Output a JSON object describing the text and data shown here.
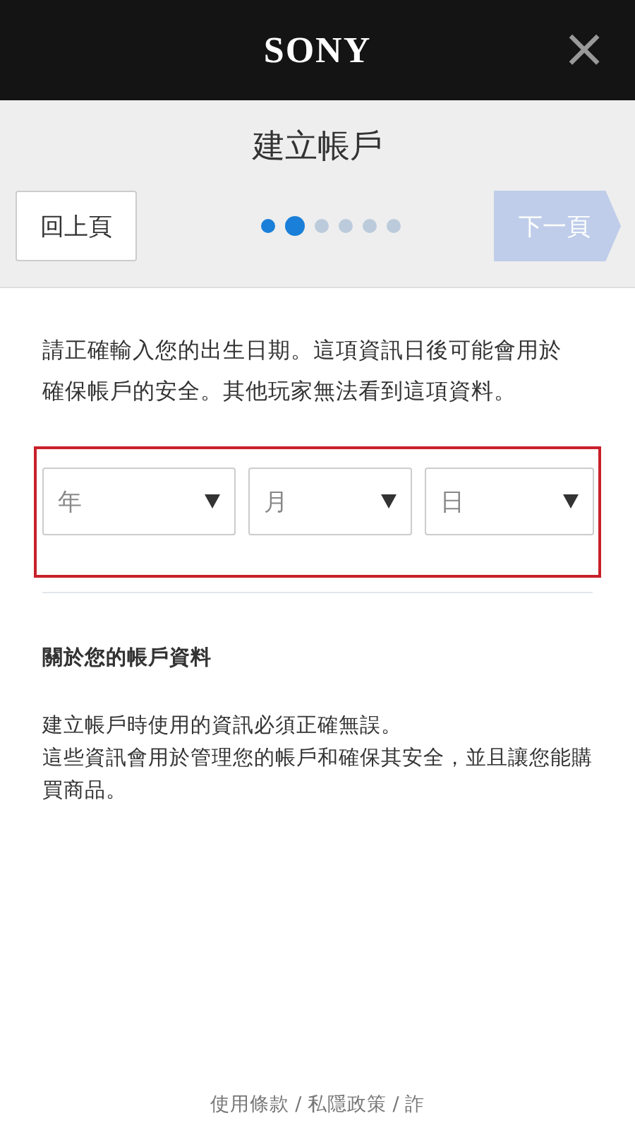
{
  "header": {
    "logo": "SONY",
    "close": "×"
  },
  "title": "建立帳戶",
  "nav": {
    "back": "回上頁",
    "next": {
      "label": "下一頁",
      "disabled": true
    },
    "steps": [
      {
        "done": true,
        "selected": false
      },
      {
        "done": false,
        "selected": true
      },
      {
        "done": false,
        "selected": false
      },
      {
        "done": false,
        "selected": false
      },
      {
        "done": false,
        "selected": false
      },
      {
        "done": false,
        "selected": false
      }
    ]
  },
  "intro": "請正確輸入您的出生日期。這項資訊日後可能會用於確保帳戶的安全。其他玩家無法看到這項資料。",
  "birthdate": {
    "error": true,
    "selects": [
      {
        "placeholder": "年"
      },
      {
        "placeholder": "月"
      },
      {
        "placeholder": "日"
      }
    ]
  },
  "about": {
    "heading": "關於您的帳戶資料",
    "lines": [
      "建立帳戶時使用的資訊必須正確無誤。",
      "這些資訊會用於管理您的帳戶和確保其安全，並且讓您能購買商品。"
    ]
  },
  "footer": "使用條款 / 私隱政策 / 詐"
}
